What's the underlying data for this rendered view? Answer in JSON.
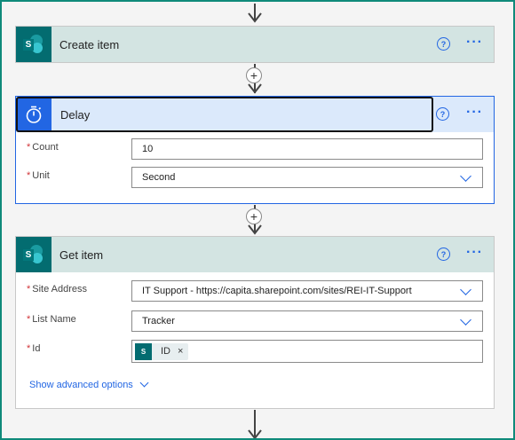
{
  "actions": {
    "create_item": {
      "title": "Create item",
      "icon": "sharepoint-icon"
    },
    "delay": {
      "title": "Delay",
      "icon": "timer-icon",
      "fields": {
        "count": {
          "label": "Count",
          "required_mark": "*",
          "value": "10"
        },
        "unit": {
          "label": "Unit",
          "required_mark": "*",
          "value": "Second"
        }
      }
    },
    "get_item": {
      "title": "Get item",
      "icon": "sharepoint-icon",
      "fields": {
        "site_address": {
          "label": "Site Address",
          "required_mark": "*",
          "value": "IT Support - https://capita.sharepoint.com/sites/REI-IT-Support"
        },
        "list_name": {
          "label": "List Name",
          "required_mark": "*",
          "value": "Tracker"
        },
        "id": {
          "label": "Id",
          "required_mark": "*",
          "token_label": "ID",
          "token_remove": "×"
        }
      },
      "advanced_options": "Show advanced options"
    }
  },
  "help_symbol": "?",
  "more_symbol": "···",
  "insert_symbol": "+",
  "colors": {
    "accent": "#2266e3",
    "sharepoint": "#036c70",
    "header_tint": "#d3e4e2",
    "delay_header": "#dbe9fb",
    "required": "#d13438",
    "frame": "#0f8a7a"
  }
}
